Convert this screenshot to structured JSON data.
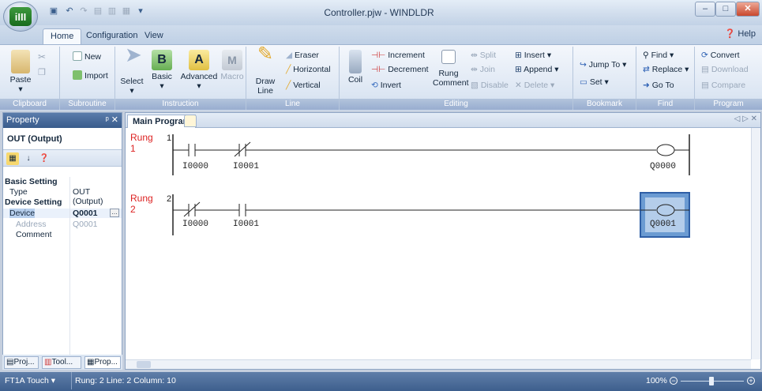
{
  "window": {
    "title": "Controller.pjw - WINDLDR",
    "app_logo": "iIII"
  },
  "tabs": [
    {
      "label": "Home",
      "active": true
    },
    {
      "label": "Configuration"
    },
    {
      "label": "View"
    }
  ],
  "help_label": "Help",
  "ribbon": {
    "clipboard": {
      "label": "Clipboard",
      "paste": "Paste"
    },
    "subroutine": {
      "label": "Subroutine",
      "new": "New",
      "import": "Import"
    },
    "instruction": {
      "label": "Instruction",
      "select": "Select",
      "basic": "Basic",
      "advanced": "Advanced",
      "macro": "Macro"
    },
    "line": {
      "label": "Line",
      "draw": "Draw",
      "draw2": "Line",
      "eraser": "Eraser",
      "horizontal": "Horizontal",
      "vertical": "Vertical"
    },
    "editing": {
      "label": "Editing",
      "coil": "Coil",
      "increment": "Increment",
      "decrement": "Decrement",
      "invert": "Invert",
      "rung": "Rung",
      "comment": "Comment",
      "split": "Split",
      "join": "Join",
      "disable": "Disable",
      "insert": "Insert",
      "append": "Append",
      "delete": "Delete"
    },
    "bookmark": {
      "label": "Bookmark",
      "jump_to": "Jump To",
      "set": "Set"
    },
    "find": {
      "label": "Find",
      "find": "Find",
      "replace": "Replace",
      "goto": "Go To"
    },
    "program": {
      "label": "Program",
      "convert": "Convert",
      "download": "Download",
      "compare": "Compare"
    }
  },
  "property": {
    "header": "Property",
    "title": "OUT (Output)",
    "rows": [
      {
        "key": "Basic Setting",
        "value": "",
        "section": true
      },
      {
        "key": "Type",
        "value": "OUT (Output)"
      },
      {
        "key": "Device Setting",
        "value": "",
        "section": true
      },
      {
        "key": "Device",
        "value": "Q0001"
      },
      {
        "key": "Address",
        "value": "Q0001"
      },
      {
        "key": "Comment",
        "value": ""
      }
    ],
    "bottom_tabs": [
      "Proj...",
      "Tool...",
      "Prop..."
    ]
  },
  "editor": {
    "tab": "Main Program",
    "rungs": [
      {
        "label": "Rung",
        "num": "1",
        "index": "1",
        "contacts": [
          "I0000",
          "I0001"
        ],
        "coil": "Q0000"
      },
      {
        "label": "Rung",
        "num": "2",
        "index": "2",
        "contacts": [
          "I0000",
          "I0001"
        ],
        "coil": "Q0001"
      }
    ]
  },
  "status": {
    "plc": "FT1A Touch",
    "position": "Rung: 2  Line: 2  Column: 10",
    "zoom": "100%"
  },
  "colors": {
    "accent": "#3e5f8d",
    "rung_label": "#dd2222",
    "selection": "#6b9bd2"
  }
}
